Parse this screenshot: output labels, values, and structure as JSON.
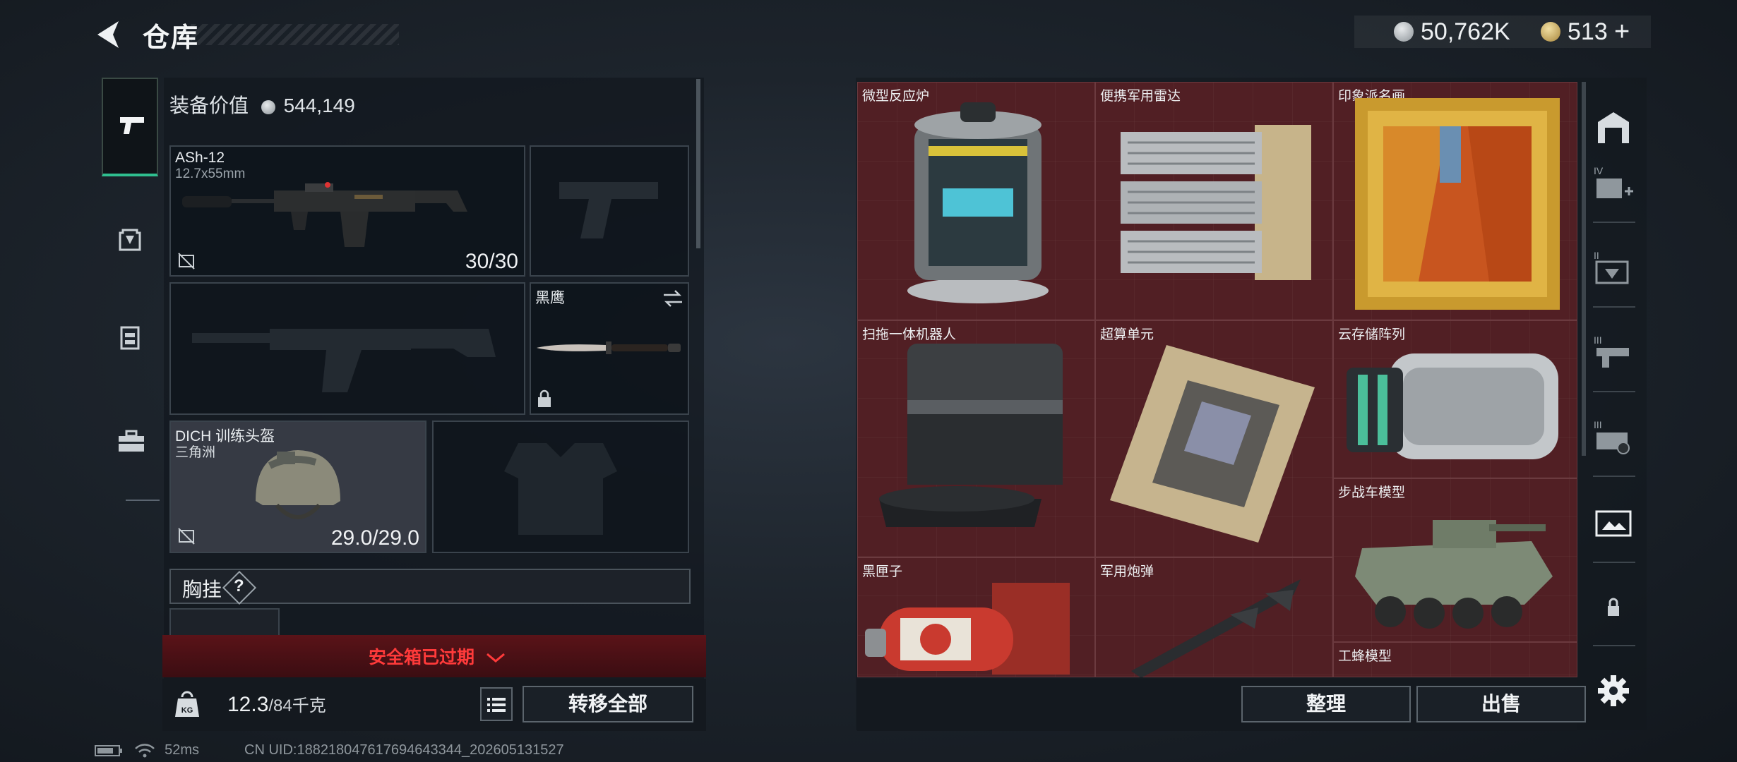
{
  "header": {
    "title": "仓库",
    "currency_silver": "50,762K",
    "currency_gold": "513",
    "currency_plus": "+"
  },
  "equipment": {
    "value_label": "装备价值",
    "value": "544,149",
    "weapon_primary": {
      "name": "ASh-12",
      "caliber": "12.7x55mm",
      "ammo": "30/30"
    },
    "melee": {
      "name": "黑鹰"
    },
    "helmet": {
      "name": "DICH 训练头盔",
      "faction": "三角洲",
      "durability": "29.0/29.0"
    },
    "vest_label": "胸挂",
    "vest_help": "?",
    "safe_box_status": "安全箱已过期",
    "weight_current": "12.3",
    "weight_max": "/84千克",
    "transfer_all": "转移全部"
  },
  "storage": {
    "items": [
      {
        "label": "微型反应炉"
      },
      {
        "label": "便携军用雷达"
      },
      {
        "label": "印象派名画"
      },
      {
        "label": "扫拖一体机器人"
      },
      {
        "label": "超算单元"
      },
      {
        "label": "云存储阵列"
      },
      {
        "label": "步战车模型"
      },
      {
        "label": "黑匣子"
      },
      {
        "label": "军用炮弹"
      },
      {
        "label": "工蜂模型"
      }
    ],
    "sort_button": "整理",
    "sell_button": "出售"
  },
  "status_bar": {
    "ping": "52ms",
    "uid": "CN UID:18821804761769464334​4_202605131527"
  },
  "colors": {
    "grid_bg": "#4a1d22",
    "active_tab": "#2fbf8f",
    "alert": "#ff3a3a"
  }
}
